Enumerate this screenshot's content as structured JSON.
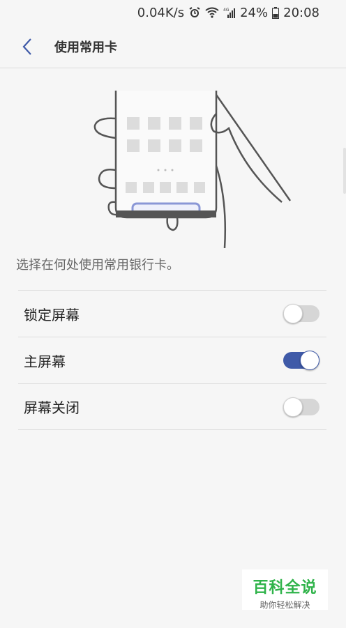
{
  "status_bar": {
    "net_speed": "0.04K/s",
    "battery_percent": "24%",
    "time": "20:08",
    "icons": [
      "alarm-icon",
      "wifi-icon",
      "signal-4g-icon",
      "battery-icon"
    ]
  },
  "header": {
    "back_icon": "chevron-left-icon",
    "title": "使用常用卡"
  },
  "description": "选择在何处使用常用银行卡。",
  "settings": [
    {
      "label": "锁定屏幕",
      "enabled": false
    },
    {
      "label": "主屏幕",
      "enabled": true
    },
    {
      "label": "屏幕关闭",
      "enabled": false
    }
  ],
  "colors": {
    "accent": "#3f5aa8",
    "toggle_off": "#d6d6d6",
    "illustration_highlight": "#8a97d6"
  },
  "watermark": {
    "title": "百科全说",
    "subtitle": "助你轻松解决"
  }
}
